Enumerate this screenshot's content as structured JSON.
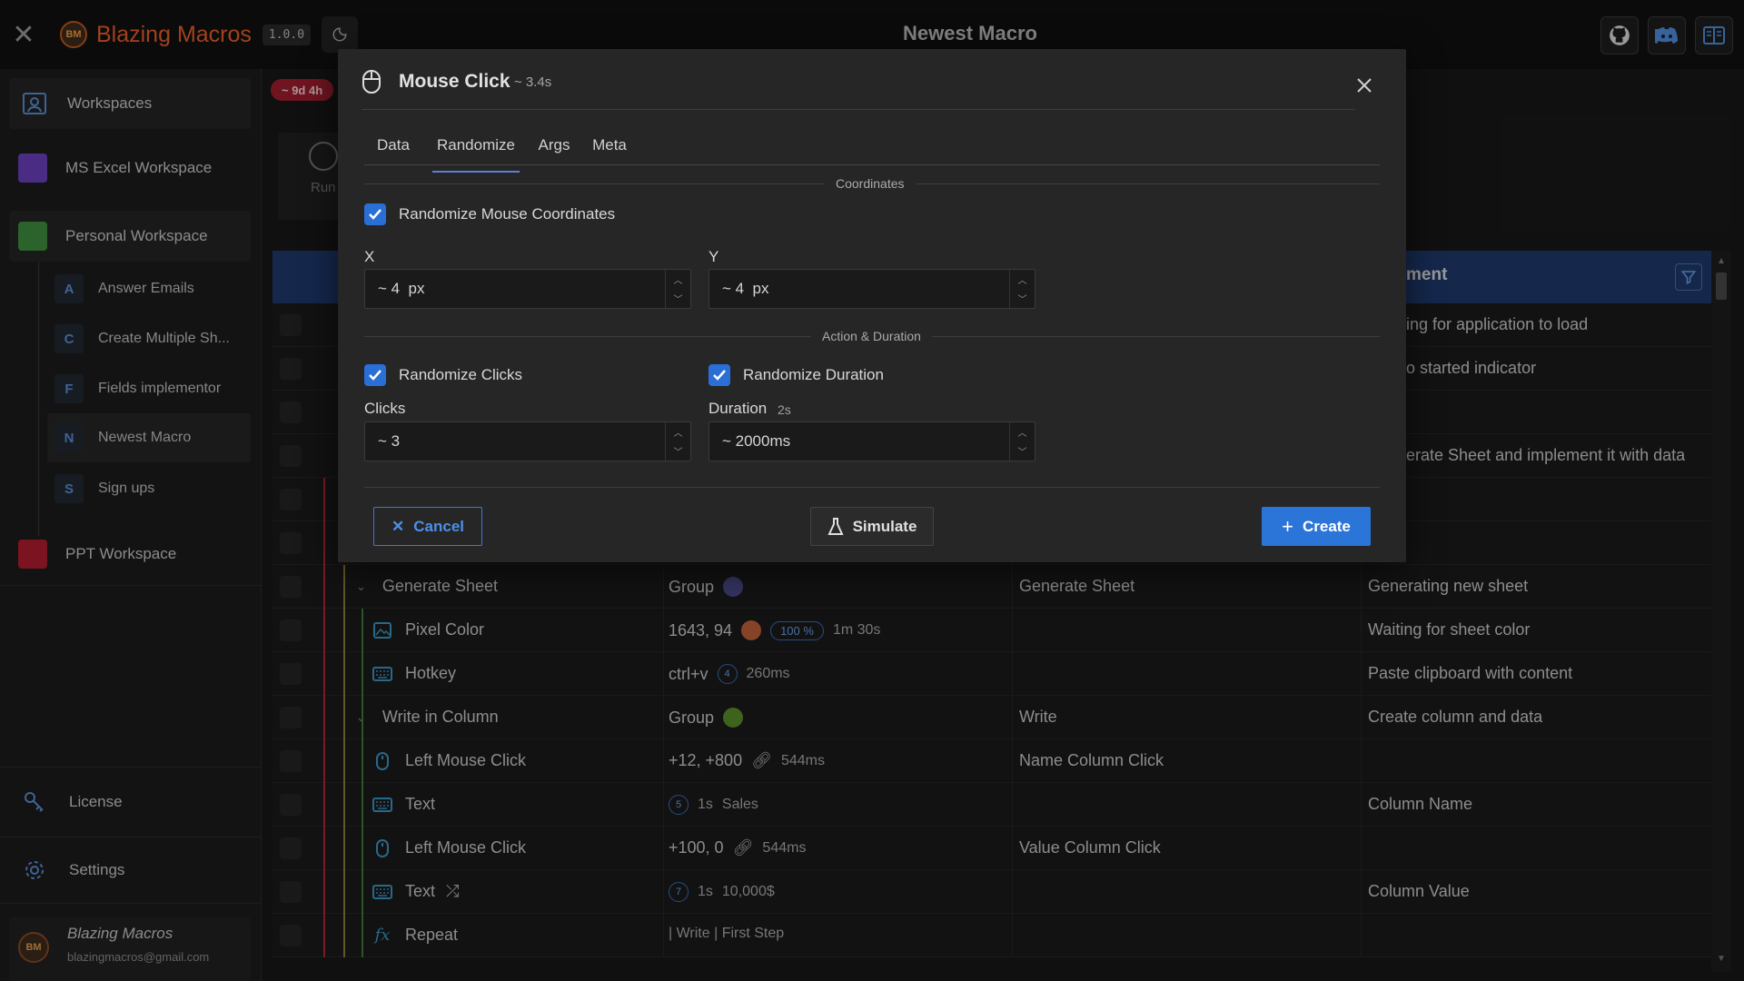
{
  "app": {
    "title": "Blazing Macros",
    "version": "1.0.0",
    "logo_text": "BM",
    "window_title": "Newest Macro"
  },
  "sidebar": {
    "workspaces_label": "Workspaces",
    "items": [
      {
        "label": "MS Excel Workspace",
        "color": "#6b3fbf"
      },
      {
        "label": "Personal Workspace",
        "color": "#3f8f3f"
      },
      {
        "label": "PPT Workspace",
        "color": "#b01e2e"
      }
    ],
    "macros": [
      {
        "letter": "A",
        "label": "Answer Emails"
      },
      {
        "letter": "C",
        "label": "Create Multiple Sh..."
      },
      {
        "letter": "F",
        "label": "Fields implementor"
      },
      {
        "letter": "N",
        "label": "Newest Macro"
      },
      {
        "letter": "S",
        "label": "Sign ups"
      }
    ],
    "license_label": "License",
    "settings_label": "Settings",
    "user": {
      "name": "Blazing Macros",
      "email": "blazingmacros@gmail.com"
    }
  },
  "main": {
    "time_badge": "~ 9d 4h",
    "run_label": "Run",
    "comment_header": "ment",
    "partial_rows": [
      "ing for application to load",
      "o started indicator",
      "erate Sheet and implement it with data"
    ],
    "rows": [
      {
        "name": "Generate Sheet",
        "icon": "chevron-down",
        "value": "Group",
        "dot": "#4a4a8a",
        "label": "Generate Sheet",
        "comment": "Generating new sheet"
      },
      {
        "name": "Pixel Color",
        "icon": "image",
        "value": "1643, 94",
        "dot": "#c0603a",
        "pct": "100 %",
        "extra": "1m 30s",
        "label": "",
        "comment": "Waiting for sheet color"
      },
      {
        "name": "Hotkey",
        "icon": "keyboard",
        "value": "ctrl+v",
        "num": "4",
        "extra": "260ms",
        "label": "",
        "comment": "Paste clipboard with content"
      },
      {
        "name": "Write in Column",
        "icon": "chevron-down",
        "value": "Group",
        "dot": "#5a8f2a",
        "label": "Write",
        "comment": "Create column and data"
      },
      {
        "name": "Left Mouse Click",
        "icon": "mouse",
        "value": "+12, +800",
        "link": true,
        "extra": "544ms",
        "label": "Name Column Click",
        "comment": ""
      },
      {
        "name": "Text",
        "icon": "keyboard",
        "num": "5",
        "value": "1s",
        "extra": "Sales",
        "label": "",
        "comment": "Column Name"
      },
      {
        "name": "Left Mouse Click",
        "icon": "mouse",
        "value": "+100, 0",
        "link": true,
        "extra": "544ms",
        "label": "Value Column Click",
        "comment": ""
      },
      {
        "name": "Text",
        "icon": "keyboard",
        "shuffle": true,
        "num": "7",
        "value": "1s",
        "extra": "10,000$",
        "label": "",
        "comment": "Column Value"
      },
      {
        "name": "Repeat",
        "icon": "fx",
        "value": "| Write | First Step",
        "label": "",
        "comment": ""
      }
    ]
  },
  "modal": {
    "title": "Mouse Click",
    "subtitle": "~ 3.4s",
    "tabs": [
      "Data",
      "Randomize",
      "Args",
      "Meta"
    ],
    "active_tab": "Randomize",
    "coordinates_section": "Coordinates",
    "randomize_coords_label": "Randomize Mouse Coordinates",
    "x_label": "X",
    "x_value": "~ 4  px",
    "y_label": "Y",
    "y_value": "~ 4  px",
    "action_section": "Action & Duration",
    "randomize_clicks_label": "Randomize Clicks",
    "randomize_duration_label": "Randomize Duration",
    "clicks_label": "Clicks",
    "clicks_value": "~ 3",
    "duration_label": "Duration",
    "duration_hint": "2s",
    "duration_value": "~ 2000ms",
    "cancel_label": "Cancel",
    "simulate_label": "Simulate",
    "create_label": "Create",
    "accent": "#2b74d8"
  }
}
